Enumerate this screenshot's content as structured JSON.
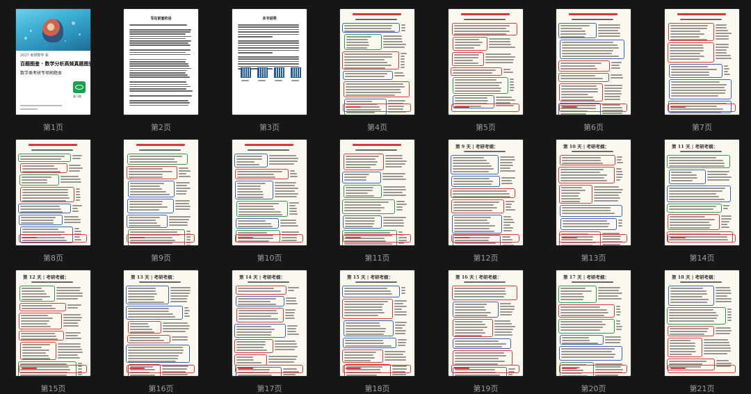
{
  "pages": [
    {
      "label": "第1页",
      "type": "cover"
    },
    {
      "label": "第2页",
      "type": "text",
      "title": "写在前面的话"
    },
    {
      "label": "第3页",
      "type": "qr",
      "title": "本书说明"
    },
    {
      "label": "第4页",
      "type": "notes"
    },
    {
      "label": "第5页",
      "type": "notes"
    },
    {
      "label": "第6页",
      "type": "notes"
    },
    {
      "label": "第7页",
      "type": "notes"
    },
    {
      "label": "第8页",
      "type": "notes"
    },
    {
      "label": "第9页",
      "type": "notes"
    },
    {
      "label": "第10页",
      "type": "notes"
    },
    {
      "label": "第11页",
      "type": "notes"
    },
    {
      "label": "第12页",
      "type": "notes",
      "big": "第 9 天 | 考研考纲："
    },
    {
      "label": "第13页",
      "type": "notes",
      "big": "第 10 天 | 考研考纲："
    },
    {
      "label": "第14页",
      "type": "notes",
      "big": "第 11 天 | 考研考纲："
    },
    {
      "label": "第15页",
      "type": "notes",
      "big": "第 12 天 | 考研考纲："
    },
    {
      "label": "第16页",
      "type": "notes",
      "big": "第 13 天 | 考研考纲："
    },
    {
      "label": "第17页",
      "type": "notes",
      "big": "第 14 天 | 考研考纲："
    },
    {
      "label": "第18页",
      "type": "notes",
      "big": "第 15 天 | 考研考纲："
    },
    {
      "label": "第19页",
      "type": "notes",
      "big": "第 16 天 | 考研考纲："
    },
    {
      "label": "第20页",
      "type": "notes",
      "big": "第 17 天 | 考研考纲："
    },
    {
      "label": "第21页",
      "type": "notes",
      "big": "第 18 天 | 考研考纲："
    }
  ],
  "cover": {
    "line1": "2027 考研数学 系",
    "line2": "百题图鉴 · 数学分析高频真题图鉴",
    "line3": "数学类考研专项刷题本",
    "badge": "复习版"
  },
  "colors": {
    "red": "#d8383a",
    "blue": "#3563b8",
    "green": "#2e9a4e",
    "bg": "#161616"
  }
}
